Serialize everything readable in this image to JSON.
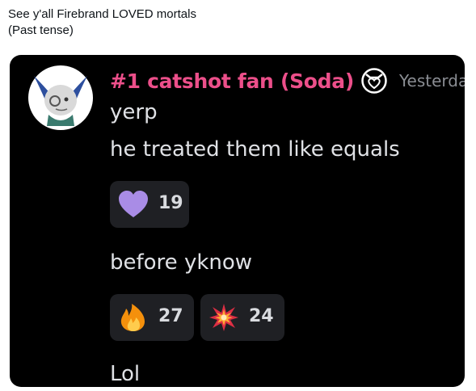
{
  "post": {
    "line1": "See y'all Firebrand LOVED mortals",
    "line2": "(Past tense)"
  },
  "message": {
    "username": "#1 catshot fan (Soda)",
    "timestamp": "Yesterday",
    "badge_icon": "heart-shield-icon",
    "lines": [
      "yerp",
      "he treated them like equals",
      "before yknow",
      "Lol"
    ],
    "username_color": "#ec4f8a"
  },
  "reactions": {
    "group1": [
      {
        "emoji": "purple-heart-icon",
        "count": "19"
      }
    ],
    "group2": [
      {
        "emoji": "fire-icon",
        "count": "27"
      },
      {
        "emoji": "collision-icon",
        "count": "24"
      }
    ]
  }
}
